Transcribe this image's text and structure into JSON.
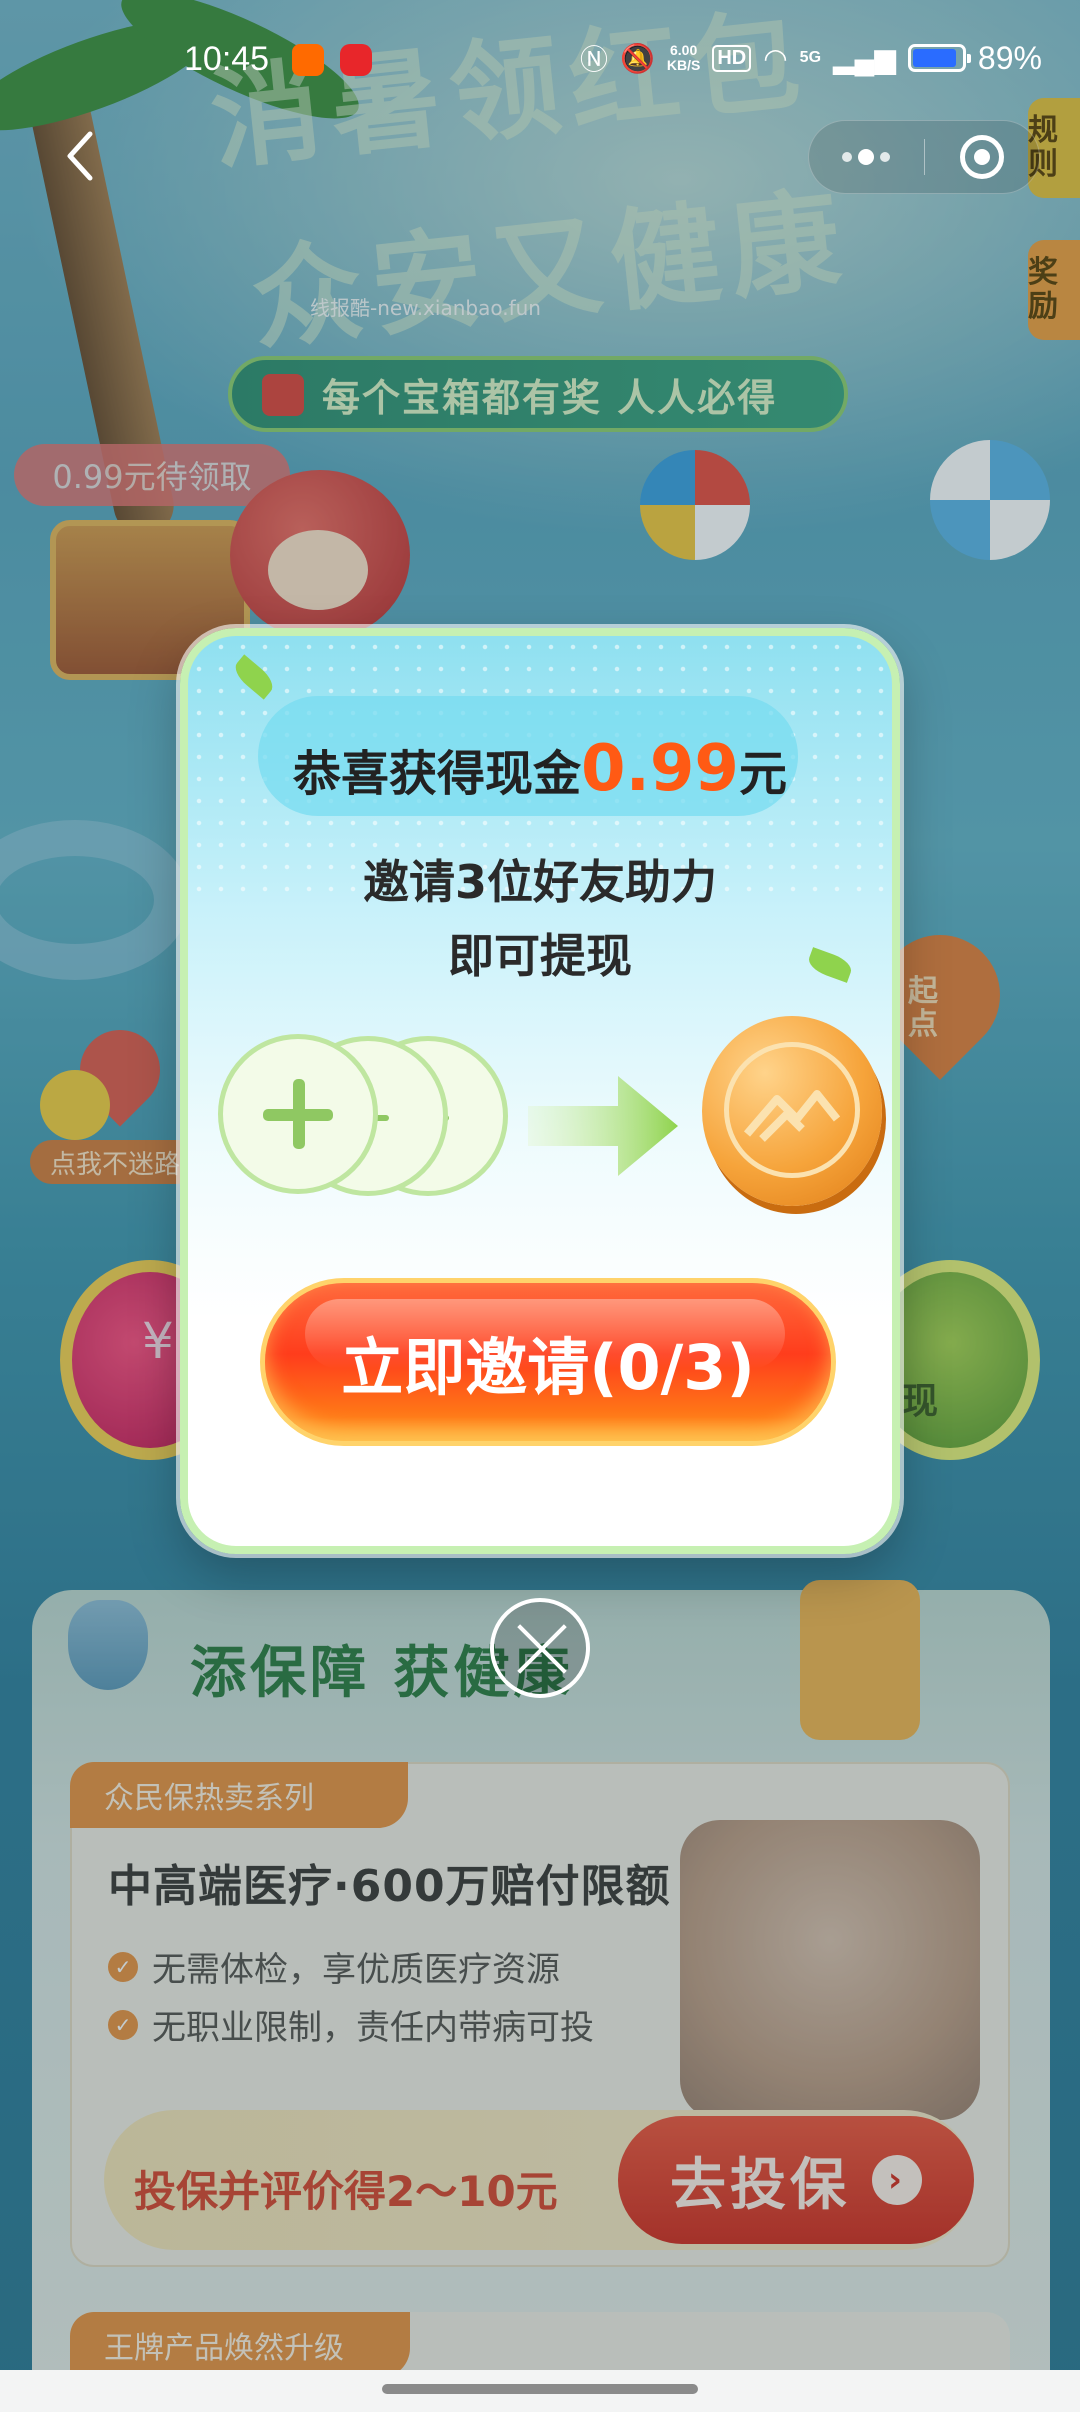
{
  "status_bar": {
    "time": "10:45",
    "net_speed_value": "6.00",
    "net_speed_unit": "KB/S",
    "hd_label": "HD",
    "network": "5G",
    "battery": "89%",
    "battery_level": 0.89,
    "icons": [
      "app-58-icon",
      "netease-music-icon",
      "nfc-icon",
      "mute-bell-icon",
      "wifi-icon",
      "signal-icon",
      "battery-icon"
    ]
  },
  "nav": {
    "back_icon": "chevron-left-icon",
    "more_icon": "more-dots-icon",
    "target_icon": "target-icon"
  },
  "background": {
    "headline_line1": "消暑领红包",
    "headline_line2": "众安又健康",
    "watermark": "线报酷-new.xianbao.fun",
    "ribbon": "每个宝箱都有奖 人人必得",
    "pending_badge": "0.99元待领取",
    "side_tab_rules": "规则",
    "side_tab_rewards": "奖励",
    "lost_badge": "点我不迷路",
    "start_label": "起点",
    "left_coin_symbol": "¥",
    "right_coin_label": "现",
    "insurance_heading": "添保障 获健康",
    "hot_tag": "众民保热卖系列",
    "hot_title": "中高端医疗·600万赔付限额",
    "features": [
      "无需体检，享优质医疗资源",
      "无职业限制，责任内带病可投"
    ],
    "cta_left": "投保并评价得2～10元",
    "cta_button": "去投保",
    "upgrade_tag": "王牌产品焕然升级"
  },
  "modal": {
    "title_prefix": "恭喜获得现金",
    "amount": "0.99",
    "title_suffix": "元",
    "line1": "邀请3位好友助力",
    "line2": "即可提现",
    "invite_button": "立即邀请(0/3)",
    "close_icon": "close-icon",
    "colors": {
      "amount": "#ff5a14",
      "button": "#ff3d1c"
    }
  }
}
